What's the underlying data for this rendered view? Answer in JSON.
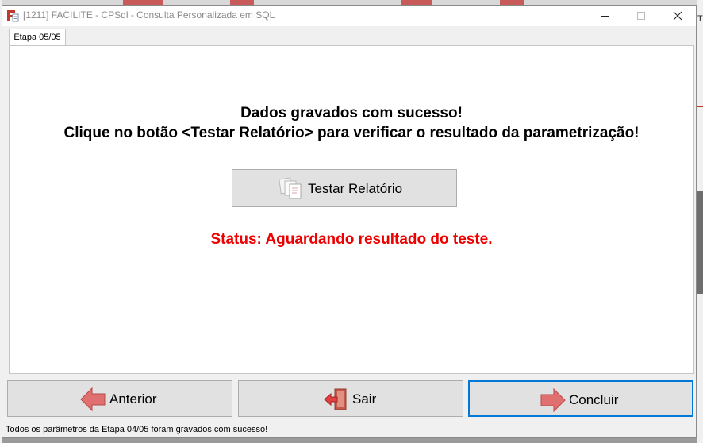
{
  "window": {
    "title": "[1211] FACILITE - CPSql - Consulta Personalizada em SQL",
    "icon": "facilite-app-icon",
    "controls": [
      "minimize-icon",
      "maximize-icon",
      "close-icon"
    ]
  },
  "tabs": [
    {
      "label": "Etapa 05/05",
      "active": true
    }
  ],
  "main": {
    "message_line1": "Dados gravados com sucesso!",
    "message_line2": "Clique no botão <Testar Relatório> para verificar o resultado da parametrização!",
    "test_button": {
      "label": "Testar Relatório",
      "icon": "report-pages-icon"
    },
    "status_text": "Status: Aguardando resultado do teste.",
    "status_color": "#ee0000"
  },
  "footer": {
    "back_button": {
      "label": "Anterior",
      "icon": "arrow-left-icon"
    },
    "exit_button": {
      "label": "Sair",
      "icon": "exit-door-icon"
    },
    "finish_button": {
      "label": "Concluir",
      "icon": "arrow-right-icon",
      "focused": true
    }
  },
  "statusbar": {
    "text": "Todos os parâmetros da Etapa 04/05 foram gravados com sucesso!"
  },
  "colors": {
    "accent": "#0078d7",
    "icon_red": "#d9534f",
    "button_bg": "#e1e1e1"
  },
  "background": {
    "edge_letter": "T"
  }
}
